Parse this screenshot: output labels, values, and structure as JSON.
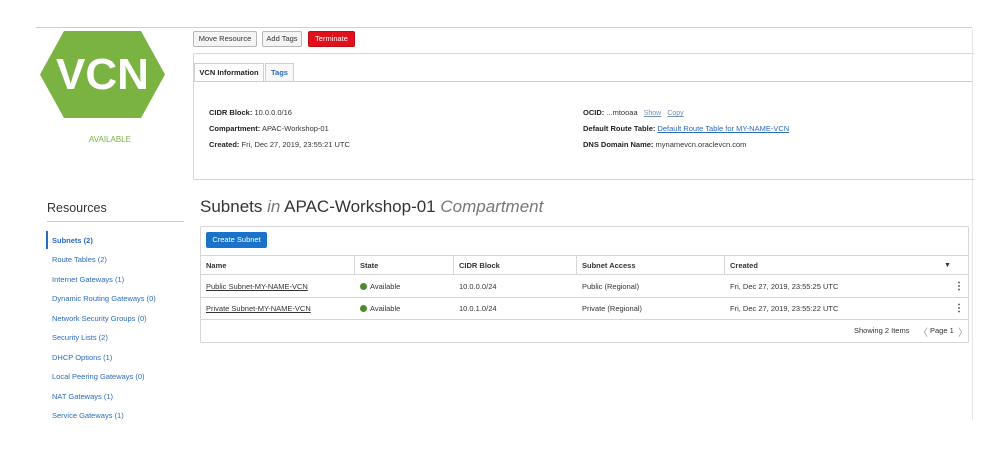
{
  "vcn": {
    "logo_text": "VCN",
    "status": "AVAILABLE",
    "colors": {
      "logo": "#7ab342",
      "status": "#7ab342"
    }
  },
  "actions": {
    "move": "Move Resource",
    "tags": "Add Tags",
    "terminate": "Terminate"
  },
  "tabs": {
    "info": "VCN Information",
    "tags": "Tags"
  },
  "info": {
    "cidr_label": "CIDR Block:",
    "cidr_value": "10.0.0.0/16",
    "compartment_label": "Compartment:",
    "compartment_value": "APAC-Workshop-01",
    "created_label": "Created:",
    "created_value": "Fri, Dec 27, 2019, 23:55:21 UTC",
    "ocid_label": "OCID:",
    "ocid_value": "...mtooaa",
    "ocid_show": "Show",
    "ocid_copy": "Copy",
    "route_label": "Default Route Table:",
    "route_value": "Default Route Table for MY-NAME-VCN",
    "dns_label": "DNS Domain Name:",
    "dns_value": "mynamevcn.oraclevcn.com"
  },
  "resources": {
    "title": "Resources",
    "items": [
      "Subnets (2)",
      "Route Tables (2)",
      "Internet Gateways (1)",
      "Dynamic Routing Gateways (0)",
      "Network Security Groups (0)",
      "Security Lists (2)",
      "DHCP Options (1)",
      "Local Peering Gateways (0)",
      "NAT Gateways (1)",
      "Service Gateways (1)"
    ]
  },
  "subnets": {
    "title_main": "Subnets",
    "title_in": "in",
    "title_compartment": "APAC-Workshop-01",
    "title_suffix": "Compartment",
    "create_button": "Create Subnet",
    "columns": [
      "Name",
      "State",
      "CIDR Block",
      "Subnet Access",
      "Created"
    ],
    "rows": [
      {
        "name": "Public Subnet-MY-NAME-VCN",
        "state": "Available",
        "cidr": "10.0.0.0/24",
        "access": "Public (Regional)",
        "created": "Fri, Dec 27, 2019, 23:55:25 UTC"
      },
      {
        "name": "Private Subnet-MY-NAME-VCN",
        "state": "Available",
        "cidr": "10.0.1.0/24",
        "access": "Private (Regional)",
        "created": "Fri, Dec 27, 2019, 23:55:22 UTC"
      }
    ],
    "showing": "Showing 2 Items",
    "page": "Page 1",
    "colors": {
      "state_dot": "#4d8a2b",
      "create_button": "#1a73c9",
      "terminate": "#e0101d"
    }
  }
}
